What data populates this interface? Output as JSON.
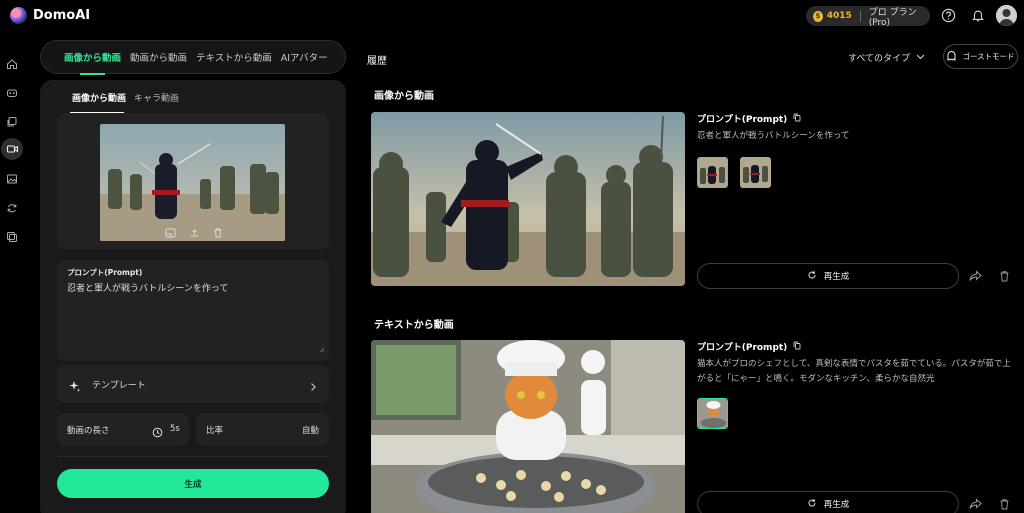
{
  "app": {
    "brand": "DomoAI"
  },
  "header": {
    "credits": "4015",
    "plan": "プロ プラン(Pro)",
    "coin_symbol": "$"
  },
  "rail": {
    "icons": [
      "home-icon",
      "discover-icon",
      "assets-icon",
      "video-icon",
      "image-icon",
      "sync-icon",
      "library-icon"
    ],
    "active_index": 3
  },
  "mode_tabs": [
    {
      "label": "画像から動画",
      "active": true
    },
    {
      "label": "動画から動画",
      "active": false
    },
    {
      "label": "テキストから動画",
      "active": false
    },
    {
      "label": "AIアバター",
      "active": false
    }
  ],
  "panel": {
    "subtabs": [
      {
        "label": "画像から動画",
        "active": true
      },
      {
        "label": "キャラ動画",
        "active": false
      }
    ],
    "prompt_label": "プロンプト(Prompt)",
    "prompt_value": "忍者と軍人が戦うバトルシーンを作って",
    "template_label": "テンプレート",
    "length_label": "動画の長さ",
    "length_value": "5s",
    "ratio_label": "比率",
    "ratio_value": "自動",
    "generate_label": "生成"
  },
  "history": {
    "title": "履歴",
    "filter_label": "すべてのタイプ",
    "ghost_label": "ゴーストモード",
    "items": [
      {
        "section": "画像から動画",
        "prompt_heading": "プロンプト(Prompt)",
        "prompt_text": "忍者と軍人が戦うバトルシーンを作って",
        "regenerate_label": "再生成"
      },
      {
        "section": "テキストから動画",
        "prompt_heading": "プロンプト(Prompt)",
        "prompt_text": "猫本人がプロのシェフとして、真剣な表情でパスタを茹でている。パスタが茹で上がると「にゃー」と鳴く。モダンなキッチン、柔らかな自然光",
        "regenerate_label": "再生成"
      }
    ]
  },
  "colors": {
    "accent": "#22e89a",
    "coin": "#e7b63a",
    "background": "#000000",
    "panel": "#1a1a1a"
  }
}
